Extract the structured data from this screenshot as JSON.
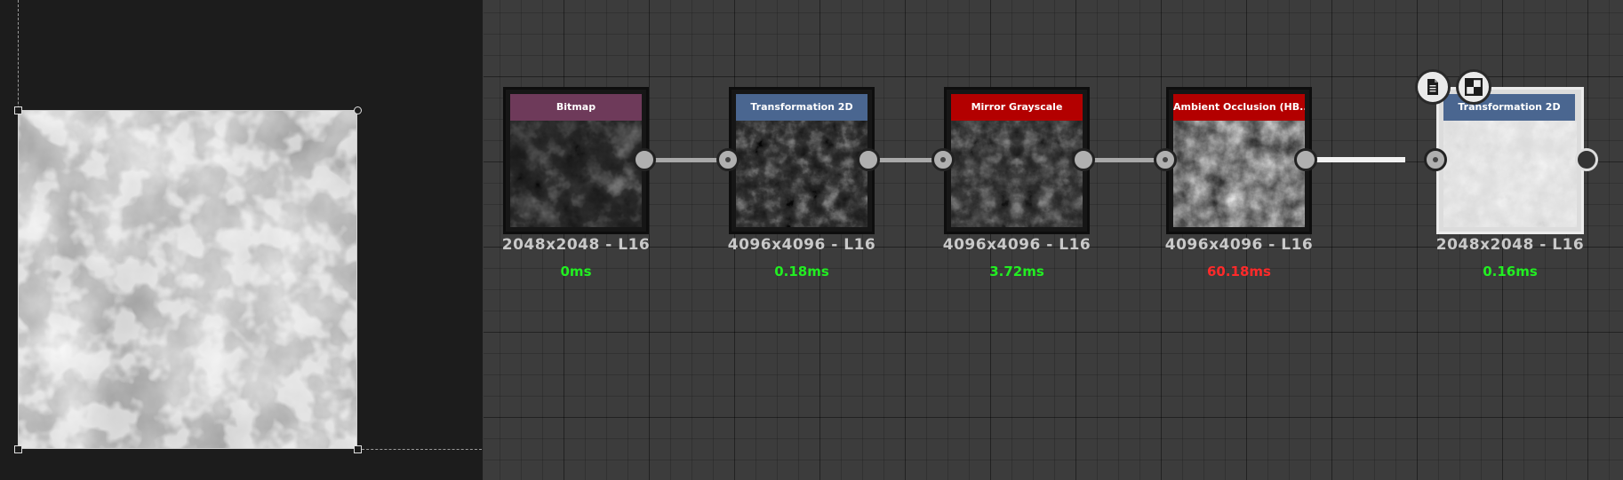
{
  "nodes": [
    {
      "title": "Bitmap",
      "header_color": "#6e3a5a",
      "resolution": "2048x2048 - L16",
      "time": "0ms",
      "time_color": "#22ee22"
    },
    {
      "title": "Transformation 2D",
      "header_color": "#4a6690",
      "resolution": "4096x4096 - L16",
      "time": "0.18ms",
      "time_color": "#22ee22"
    },
    {
      "title": "Mirror Grayscale",
      "header_color": "#b30000",
      "resolution": "4096x4096 - L16",
      "time": "3.72ms",
      "time_color": "#22ee22"
    },
    {
      "title": "Ambient Occlusion (HB...",
      "header_color": "#b30000",
      "resolution": "4096x4096 - L16",
      "time": "60.18ms",
      "time_color": "#ff2a2a"
    },
    {
      "title": "Transformation 2D",
      "header_color": "#4a6690",
      "resolution": "2048x2048 - L16",
      "time": "0.16ms",
      "time_color": "#22ee22"
    }
  ],
  "selected_node_icons": [
    "document-icon",
    "checker-icon"
  ],
  "colors": {
    "canvas_bg": "#3c3c3c",
    "view_bg": "#1c1c1c",
    "wire": "#a9a9a9",
    "selected_wire": "#f2f2f2"
  }
}
